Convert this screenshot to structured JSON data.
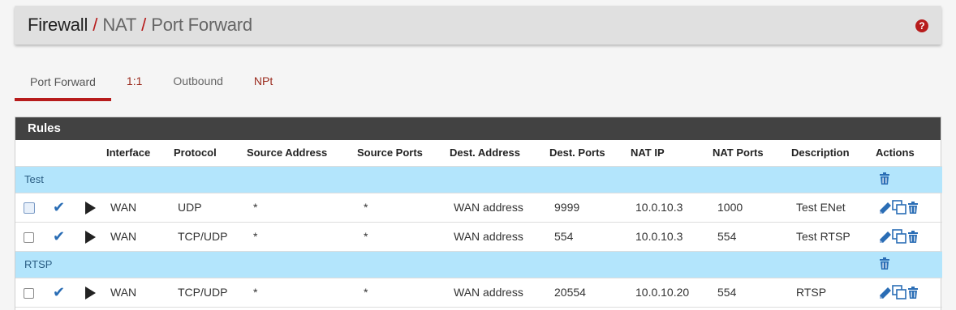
{
  "breadcrumb": {
    "items": [
      "Firewall",
      "NAT",
      "Port Forward"
    ],
    "separator": "/"
  },
  "help_icon": "?",
  "tabs": [
    {
      "label": "Port Forward",
      "active": true
    },
    {
      "label": "1:1"
    },
    {
      "label": "Outbound"
    },
    {
      "label": "NPt"
    }
  ],
  "panel": {
    "title": "Rules"
  },
  "columns": [
    "Interface",
    "Protocol",
    "Source Address",
    "Source Ports",
    "Dest. Address",
    "Dest. Ports",
    "NAT IP",
    "NAT Ports",
    "Description",
    "Actions"
  ],
  "groups": [
    {
      "name": "Test",
      "rules": [
        {
          "interface": "WAN",
          "protocol": "UDP",
          "source_address": "*",
          "source_ports": "*",
          "dest_address": "WAN address",
          "dest_ports": "9999",
          "nat_ip": "10.0.10.3",
          "nat_ports": "1000",
          "description": "Test ENet"
        },
        {
          "interface": "WAN",
          "protocol": "TCP/UDP",
          "source_address": "*",
          "source_ports": "*",
          "dest_address": "WAN address",
          "dest_ports": "554",
          "nat_ip": "10.0.10.3",
          "nat_ports": "554",
          "description": "Test RTSP"
        }
      ]
    },
    {
      "name": "RTSP",
      "rules": [
        {
          "interface": "WAN",
          "protocol": "TCP/UDP",
          "source_address": "*",
          "source_ports": "*",
          "dest_address": "WAN address",
          "dest_ports": "20554",
          "nat_ip": "10.0.10.20",
          "nat_ports": "554",
          "description": "RTSP"
        }
      ]
    }
  ],
  "colors": {
    "accent": "#b71c1c",
    "separator_bg": "#b3e5fc",
    "icon_blue": "#2a6db5",
    "heading_bg": "#424242"
  }
}
